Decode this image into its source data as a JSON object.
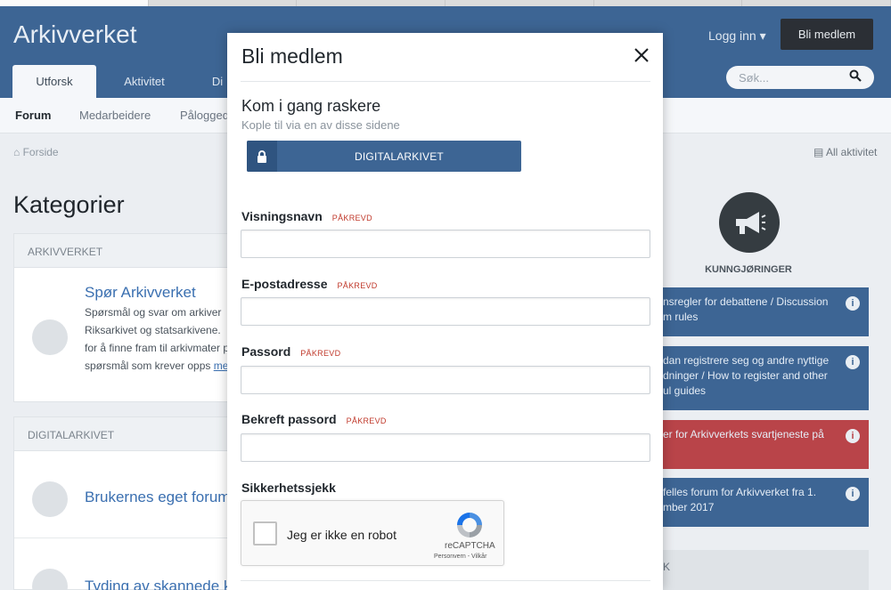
{
  "site": {
    "brand": "Arkivverket",
    "login": "Logg inn",
    "join": "Bli medlem",
    "tabs": [
      "Utforsk",
      "Aktivitet",
      "Di"
    ],
    "search_placeholder": "Søk..."
  },
  "subnav": [
    "Forum",
    "Medarbeidere",
    "Påloggede"
  ],
  "breadcrumb": "Forside",
  "all_activity": "All aktivitet",
  "page_title": "Kategorier",
  "categories": [
    {
      "header": "ARKIVVERKET",
      "title": "Spør Arkivverket",
      "desc": "Spørsmål og svar om arkiver Riksarkivet og statsarkivene. for å finne fram til arkivmater på spørsmål som krever opps",
      "more": "mer"
    },
    {
      "header": "DIGITALARKIVET",
      "title": "Brukernes eget forum",
      "title2": "Tyding av skannede k"
    }
  ],
  "sidebar": {
    "announcements_label": "KUNNGJØRINGER",
    "cards": [
      "nsregler for debattene / Discussion m rules",
      "dan registrere seg og andre nyttige dninger / How to register and other ul guides",
      "er for Arkivverkets svartjeneste på",
      "felles forum for Arkivverket fra 1. mber 2017"
    ],
    "bottom_label": "K"
  },
  "modal": {
    "title": "Bli medlem",
    "quick_title": "Kom i gang raskere",
    "quick_sub": "Kople til via en av disse sidene",
    "provider_button": "DIGITALARKIVET",
    "required": "PÅKREVD",
    "fields": {
      "display_name": "Visningsnavn",
      "email": "E-postadresse",
      "password": "Passord",
      "confirm_password": "Bekreft passord"
    },
    "security_check": "Sikkerhetssjekk",
    "captcha": {
      "text": "Jeg er ikke en robot",
      "brand": "reCAPTCHA",
      "terms": "Personvern - Vilkår"
    }
  },
  "colors": {
    "header_blue": "#3d6594",
    "required_red": "#c0392b",
    "alert_red": "#b94449"
  }
}
